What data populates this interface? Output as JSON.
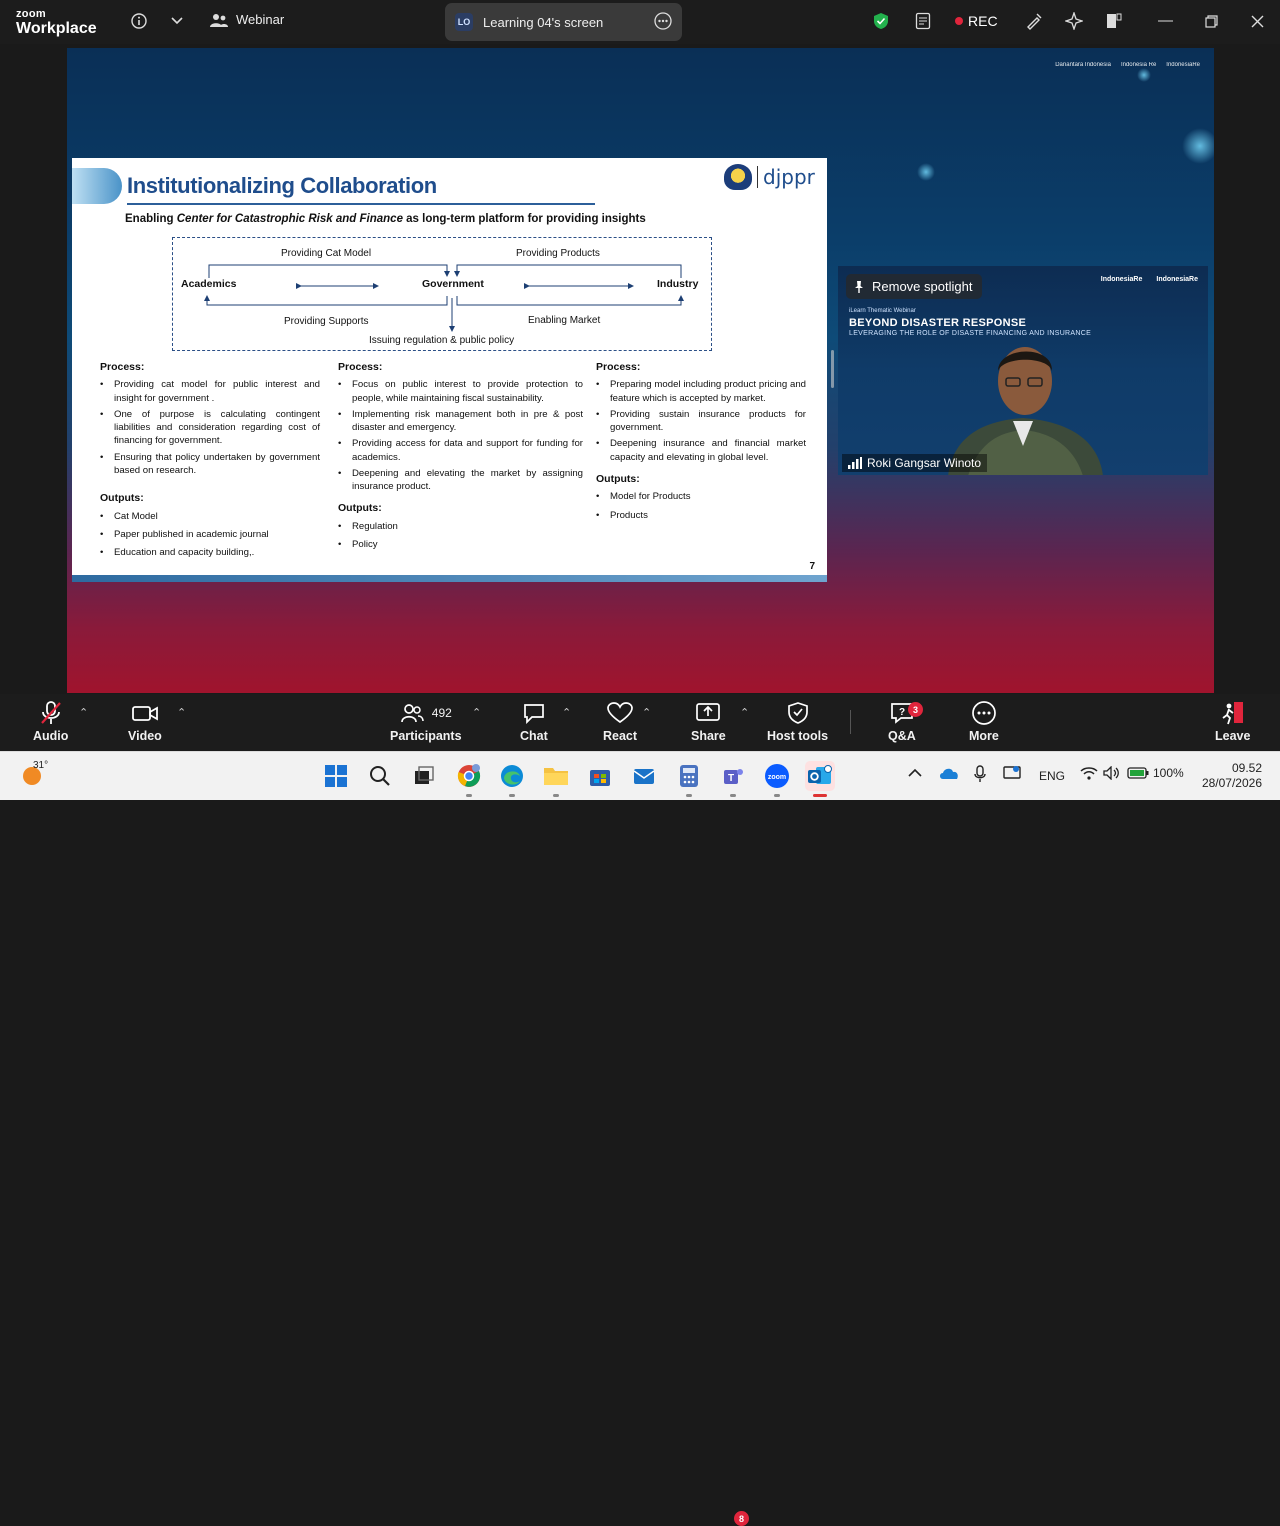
{
  "app": {
    "brand_top": "zoom",
    "brand_bottom": "Workplace",
    "meeting_type": "Webinar",
    "share_badge": "LO",
    "share_label": "Learning 04's screen",
    "rec_label": "REC"
  },
  "slide": {
    "title": "Institutionalizing Collaboration",
    "logo_text": "djppr",
    "subtitle_pre": "Enabling ",
    "subtitle_em": "Center for Catastrophic Risk and Finance",
    "subtitle_post": " as long-term platform for providing insights",
    "diagram": {
      "node_left": "Academics",
      "node_center": "Government",
      "node_right": "Industry",
      "top_left": "Providing Cat Model",
      "top_right": "Providing Products",
      "bottom_left": "Providing Supports",
      "bottom_right": "Enabling Market",
      "bottom_center": "Issuing regulation & public policy"
    },
    "columns": [
      {
        "process_heading": "Process:",
        "process": [
          "Providing cat model for public interest and insight for government .",
          "One of purpose is calculating contingent liabilities and consideration regarding cost of financing for government.",
          "Ensuring that policy undertaken by government based on research."
        ],
        "outputs_heading": "Outputs:",
        "outputs": [
          "Cat Model",
          "Paper published in academic journal",
          "Education and capacity building,."
        ]
      },
      {
        "process_heading": "Process:",
        "process": [
          "Focus on public interest to provide protection to people, while maintaining fiscal sustainability.",
          "Implementing risk management both in pre & post disaster and emergency.",
          "Providing access for data and support for funding for academics.",
          "Deepening and elevating the market by assigning insurance product."
        ],
        "outputs_heading": "Outputs:",
        "outputs": [
          "Regulation",
          "Policy"
        ]
      },
      {
        "process_heading": "Process:",
        "process": [
          "Preparing model including product pricing and feature which is accepted by market.",
          "Providing sustain insurance products for government.",
          "Deepening insurance and financial market capacity and elevating in global level."
        ],
        "outputs_heading": "Outputs:",
        "outputs": [
          "Model for Products",
          "Products"
        ]
      }
    ],
    "page_number": "7"
  },
  "background": {
    "logo_left": "Danantara Indonesia",
    "logo_mid": "Indonesia Re",
    "logo_right": "IndonesiaRe"
  },
  "video": {
    "spotlight_label": "Remove spotlight",
    "logo_a": "IndonesiaRe",
    "logo_b": "IndonesiaRe",
    "event_small": "iLearn Thematic Webinar",
    "event_title": "BEYOND DISASTER RESPONSE",
    "event_sub": "LEVERAGING THE ROLE OF DISASTE     FINANCING AND INSURANCE",
    "speaker_name": "Roki Gangsar Winoto"
  },
  "toolbar": {
    "audio": "Audio",
    "video": "Video",
    "participants": "Participants",
    "participants_count": "492",
    "chat": "Chat",
    "react": "React",
    "share": "Share",
    "host_tools": "Host tools",
    "qa": "Q&A",
    "qa_badge": "3",
    "more": "More",
    "leave": "Leave"
  },
  "taskbar": {
    "temperature": "31°",
    "teams_badge": "8",
    "language": "ENG",
    "battery": "100%",
    "time": "09.52",
    "date": "28/07/2026"
  }
}
